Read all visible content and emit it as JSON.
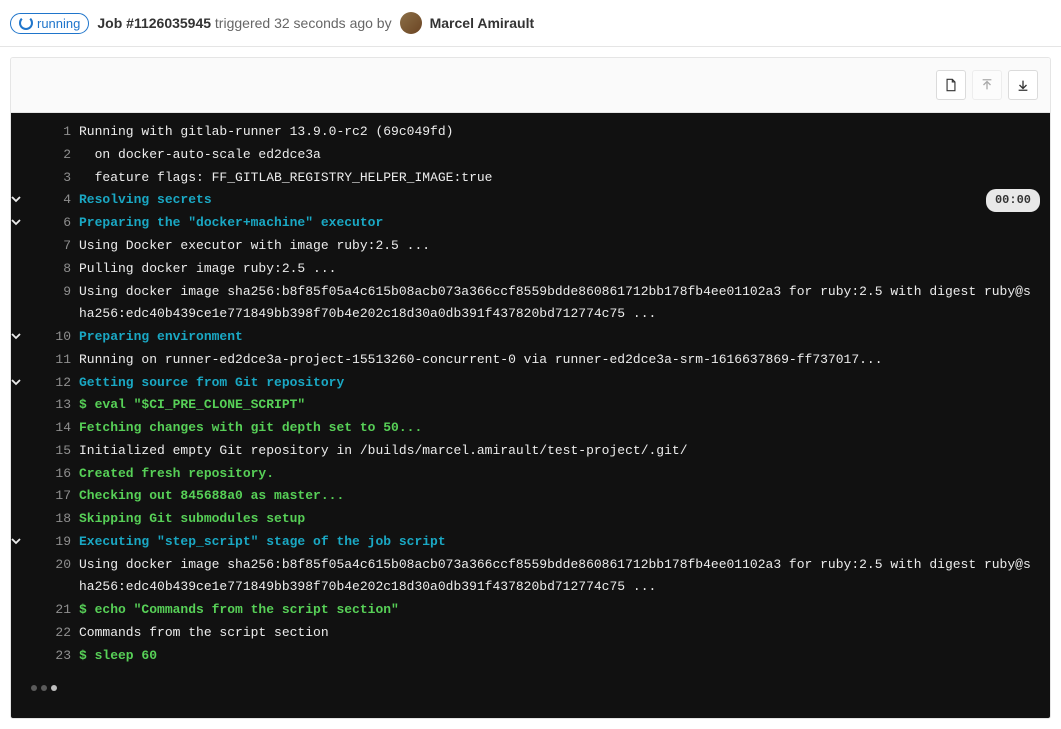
{
  "header": {
    "status": "running",
    "job_prefix": "Job",
    "job_id": "#1126035945",
    "triggered": "triggered 32 seconds ago by",
    "user": "Marcel Amirault"
  },
  "log": {
    "lines": [
      {
        "n": 1,
        "c": false,
        "cls": "white",
        "t": "Running with gitlab-runner 13.9.0-rc2 (69c049fd)"
      },
      {
        "n": 2,
        "c": false,
        "cls": "white",
        "t": "  on docker-auto-scale ed2dce3a"
      },
      {
        "n": 3,
        "c": false,
        "cls": "white",
        "t": "  feature flags: FF_GITLAB_REGISTRY_HELPER_IMAGE:true"
      },
      {
        "n": 4,
        "c": true,
        "cls": "cyan",
        "t": "Resolving secrets",
        "dur": "00:00"
      },
      {
        "n": 6,
        "c": true,
        "cls": "cyan",
        "t": "Preparing the \"docker+machine\" executor"
      },
      {
        "n": 7,
        "c": false,
        "cls": "white",
        "t": "Using Docker executor with image ruby:2.5 ..."
      },
      {
        "n": 8,
        "c": false,
        "cls": "white",
        "t": "Pulling docker image ruby:2.5 ..."
      },
      {
        "n": 9,
        "c": false,
        "cls": "white",
        "t": "Using docker image sha256:b8f85f05a4c615b08acb073a366ccf8559bdde860861712bb178fb4ee01102a3 for ruby:2.5 with digest ruby@sha256:edc40b439ce1e771849bb398f70b4e202c18d30a0db391f437820bd712774c75 ..."
      },
      {
        "n": 10,
        "c": true,
        "cls": "cyan",
        "t": "Preparing environment"
      },
      {
        "n": 11,
        "c": false,
        "cls": "white",
        "t": "Running on runner-ed2dce3a-project-15513260-concurrent-0 via runner-ed2dce3a-srm-1616637869-ff737017..."
      },
      {
        "n": 12,
        "c": true,
        "cls": "cyan",
        "t": "Getting source from Git repository"
      },
      {
        "n": 13,
        "c": false,
        "cls": "green",
        "t": "$ eval \"$CI_PRE_CLONE_SCRIPT\""
      },
      {
        "n": 14,
        "c": false,
        "cls": "green",
        "t": "Fetching changes with git depth set to 50..."
      },
      {
        "n": 15,
        "c": false,
        "cls": "white",
        "t": "Initialized empty Git repository in /builds/marcel.amirault/test-project/.git/"
      },
      {
        "n": 16,
        "c": false,
        "cls": "green",
        "t": "Created fresh repository."
      },
      {
        "n": 17,
        "c": false,
        "cls": "green",
        "t": "Checking out 845688a0 as master..."
      },
      {
        "n": 18,
        "c": false,
        "cls": "green",
        "t": "Skipping Git submodules setup"
      },
      {
        "n": 19,
        "c": true,
        "cls": "cyan",
        "t": "Executing \"step_script\" stage of the job script"
      },
      {
        "n": 20,
        "c": false,
        "cls": "white",
        "t": "Using docker image sha256:b8f85f05a4c615b08acb073a366ccf8559bdde860861712bb178fb4ee01102a3 for ruby:2.5 with digest ruby@sha256:edc40b439ce1e771849bb398f70b4e202c18d30a0db391f437820bd712774c75 ..."
      },
      {
        "n": 21,
        "c": false,
        "cls": "green",
        "t": "$ echo \"Commands from the script section\""
      },
      {
        "n": 22,
        "c": false,
        "cls": "white",
        "t": "Commands from the script section"
      },
      {
        "n": 23,
        "c": false,
        "cls": "green",
        "t": "$ sleep 60"
      }
    ]
  }
}
